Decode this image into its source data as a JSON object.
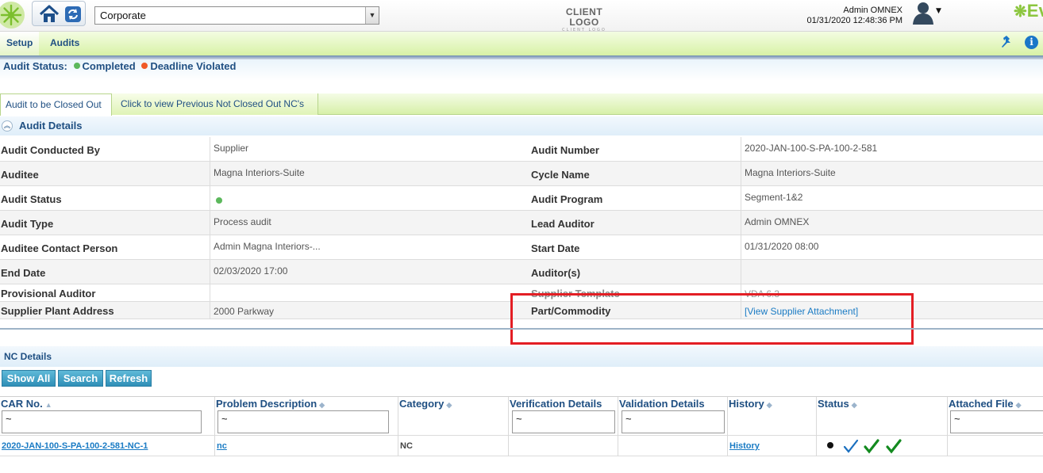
{
  "header": {
    "location_select": "Corporate",
    "client_logo_main": "CLIENT LOGO",
    "client_logo_sub": "CLIENT LOGO",
    "user_name": "Admin OMNEX",
    "datetime": "01/31/2020 12:48:36 PM",
    "brand_text": "Ev"
  },
  "menu": {
    "items": [
      {
        "label": "Setup"
      },
      {
        "label": "Audits"
      }
    ]
  },
  "audit_status": {
    "label": "Audit Status:",
    "legend": [
      {
        "label": "Completed",
        "color": "#5cb85c"
      },
      {
        "label": "Deadline Violated",
        "color": "#f05a28"
      }
    ]
  },
  "tabs": [
    {
      "label": "Audit to be Closed Out",
      "active": true
    },
    {
      "label": "Click to view Previous Not Closed Out NC's",
      "active": false
    }
  ],
  "audit_details": {
    "title": "Audit Details",
    "rows": [
      {
        "l1": "Audit Conducted By",
        "v1": "Supplier",
        "l2": "Audit Number",
        "v2": "2020-JAN-100-S-PA-100-2-581"
      },
      {
        "l1": "Auditee",
        "v1": "Magna Interiors-Suite",
        "l2": "Cycle Name",
        "v2": "Magna Interiors-Suite"
      },
      {
        "l1": "Audit Status",
        "v1": "",
        "l2": "Audit Program",
        "v2": "Segment-1&2"
      },
      {
        "l1": "Audit Type",
        "v1": "Process audit",
        "l2": "Lead Auditor",
        "v2": "Admin OMNEX"
      },
      {
        "l1": "Auditee Contact Person",
        "v1": "Admin Magna Interiors-...",
        "l2": "Start Date",
        "v2": "01/31/2020 08:00"
      },
      {
        "l1": "End Date",
        "v1": "02/03/2020 17:00",
        "l2": "Auditor(s)",
        "v2": ""
      },
      {
        "l1": "Provisional Auditor",
        "v1": "",
        "l2": "Supplier Template",
        "v2": "VDA 6.3"
      },
      {
        "l1": "Supplier Plant Address",
        "v1": "2000 Parkway",
        "l2": "Part/Commodity",
        "v2": "[View Supplier Attachment]"
      }
    ]
  },
  "nc_details": {
    "title": "NC Details",
    "buttons": [
      {
        "label": "Show All"
      },
      {
        "label": "Search"
      },
      {
        "label": "Refresh"
      }
    ],
    "columns": [
      {
        "label": "CAR No."
      },
      {
        "label": "Problem Description"
      },
      {
        "label": "Category"
      },
      {
        "label": "Verification Details"
      },
      {
        "label": "Validation Details"
      },
      {
        "label": "History"
      },
      {
        "label": "Status"
      },
      {
        "label": "Attached File"
      }
    ],
    "filter_value": "~",
    "rows": [
      {
        "car_no": "2020-JAN-100-S-PA-100-2-581-NC-1",
        "problem": "nc",
        "category": "NC",
        "verification": "",
        "validation": "",
        "history": "History",
        "attached": ""
      }
    ]
  }
}
